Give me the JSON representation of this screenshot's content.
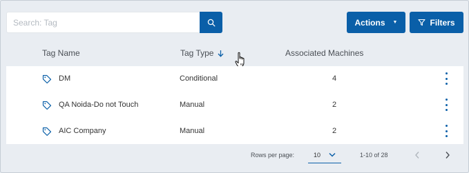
{
  "search": {
    "placeholder": "Search: Tag",
    "value": ""
  },
  "toolbar": {
    "actions_label": "Actions",
    "filters_label": "Filters"
  },
  "table": {
    "columns": [
      "Tag Name",
      "Tag Type",
      "Associated Machines"
    ],
    "sort": {
      "column": "Tag Type",
      "direction": "descending"
    },
    "rows": [
      {
        "name": "DM",
        "type": "Conditional",
        "machines": "4"
      },
      {
        "name": "QA Noida-Do not Touch",
        "type": "Manual",
        "machines": "2"
      },
      {
        "name": "AIC Company",
        "type": "Manual",
        "machines": "2"
      }
    ]
  },
  "pagination": {
    "rows_per_page_label": "Rows per page:",
    "rows_per_page_value": "10",
    "range": "1-10 of 28"
  },
  "colors": {
    "accent": "#0a5fa8",
    "background": "#e9edf2",
    "row_background": "#ffffff"
  },
  "icons": [
    "search-icon",
    "chevron-down-icon",
    "filter-icon",
    "sort-arrow-down-icon",
    "hand-cursor-icon",
    "tag-icon",
    "more-vertical-icon",
    "chevron-left-icon",
    "chevron-right-icon"
  ]
}
